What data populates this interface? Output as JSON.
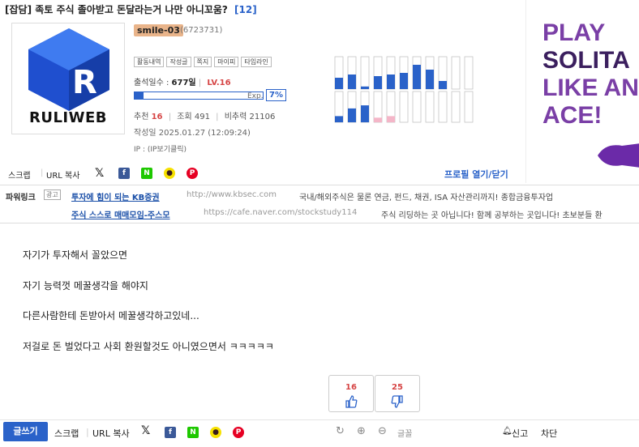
{
  "post": {
    "title": "[잡담] 족토 주식 졸아받고 돈달라는거 나만 아니꼬움?",
    "comment_count": "[12]"
  },
  "logo": {
    "word": "RULIWEB"
  },
  "author": {
    "nickname": "smile-03",
    "user_id": "(6723731)",
    "tabs": [
      "활동내역",
      "작성글",
      "쪽지",
      "마이피",
      "타임라인"
    ],
    "attendance_label": "출석일수 :",
    "attendance_value": "677일",
    "level": "LV.16",
    "exp_label": "Exp.",
    "exp_percent": "7%",
    "exp_fraction": 0.07,
    "recommend_label": "추천",
    "recommend_value": "16",
    "views_label": "조회",
    "views_value": "491",
    "downvote_label": "비추력",
    "downvote_value": "21106",
    "date_label": "작성일",
    "date_value": "2025.01.27 (12:09:24)",
    "ip_label": "IP : (IP보기클릭)"
  },
  "activity_graph": {
    "up": [
      0.35,
      0.45,
      0.08,
      0.4,
      0.45,
      0.5,
      0.75,
      0.6,
      0.25,
      0,
      0
    ],
    "down": [
      0.2,
      0.45,
      0.55,
      0.15,
      0.2,
      0,
      0,
      0,
      0,
      0,
      0
    ],
    "down_pink": [
      false,
      false,
      false,
      true,
      true,
      false,
      false,
      false,
      false,
      false,
      false
    ],
    "colors": {
      "up": "#2a62c9",
      "down": "#2a62c9",
      "pink": "#f4b6c8",
      "frame": "#bbbbbb"
    }
  },
  "share": {
    "scrap": "스크랩",
    "url_copy": "URL 복사",
    "icons": [
      "x-icon",
      "facebook-icon",
      "naver-icon",
      "kakaotalk-icon",
      "pinterest-icon"
    ],
    "profile_toggle": "프로필 열기/닫기"
  },
  "ad": {
    "lines": [
      "PLAY",
      "SOLITA",
      "LIKE AN",
      "ACE!"
    ]
  },
  "powerlink": {
    "label": "파워링크",
    "badge": "광고",
    "items": [
      {
        "title": "투자에 힘이 되는 KB증권",
        "url": "http://www.kbsec.com",
        "desc": "국내/해외주식은 물론 연금, 펀드, 채권, ISA 자산관리까지! 종합금융투자업"
      },
      {
        "title": "주식 스스로 매매모임-주스모",
        "url": "https://cafe.naver.com/stockstudy114",
        "desc": "주식 리딩하는 곳 아닙니다! 함께 공부하는 곳입니다! 초보분들 환"
      }
    ]
  },
  "content": {
    "lines": [
      "자기가 투자해서 꼴았으면",
      "자기 능력껏 메꿀생각을 해야지",
      "다른사람한테 돈받아서 메꿀생각하고있네...",
      "저걸로 돈 벌었다고 사회 환원할것도 아니였으면서 ㅋㅋㅋㅋㅋ"
    ]
  },
  "votes": {
    "up": "16",
    "down": "25"
  },
  "bottom": {
    "write": "글쓰기",
    "scrap": "스크랩",
    "url_copy": "URL 복사",
    "font_label": "글꼴",
    "report": "신고",
    "block": "차단"
  }
}
